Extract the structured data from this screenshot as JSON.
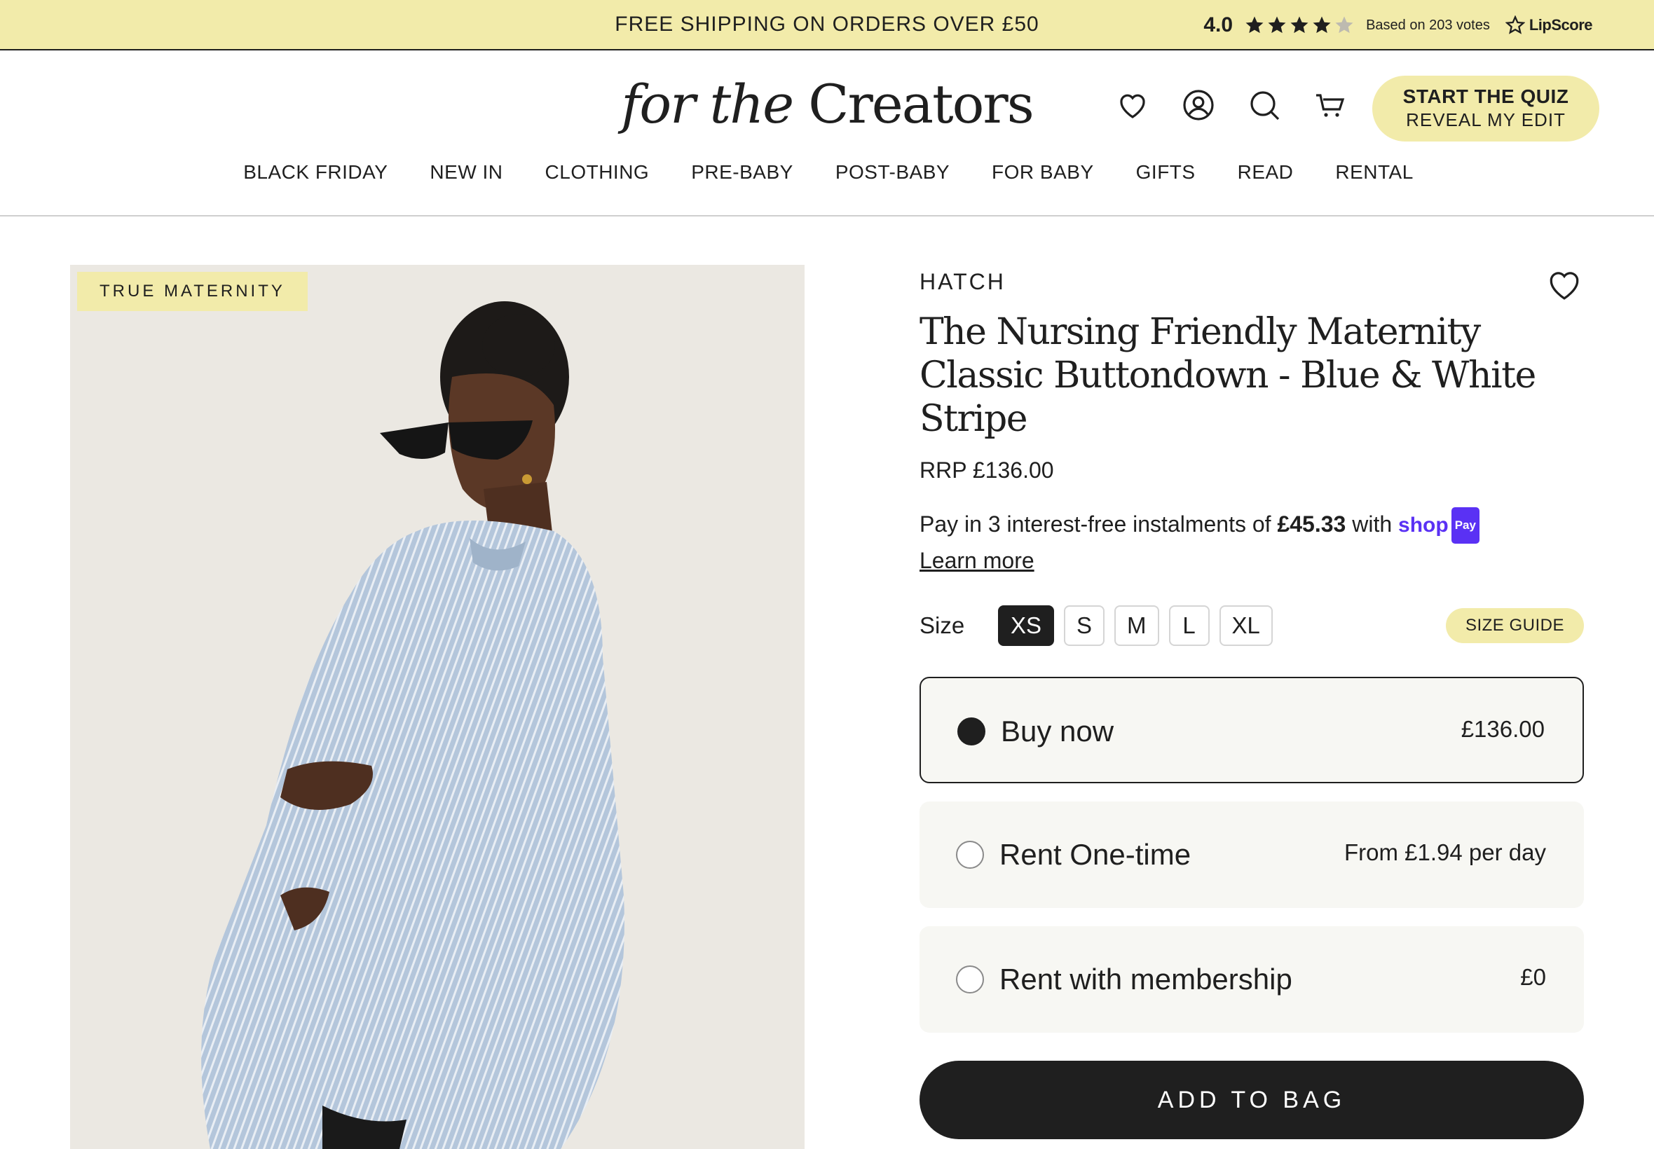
{
  "announcement": {
    "shipping_strong": "FREE SHIPPING",
    "shipping_rest": " ON ORDERS OVER £50",
    "rating_score": "4.0",
    "rating_votes": "Based on 203 votes",
    "rating_brand": "LipScore",
    "stars_filled": 4,
    "stars_total": 5
  },
  "header": {
    "logo_italic": "for the",
    "logo_rest": " Creators",
    "icons": [
      "heart-icon",
      "account-icon",
      "search-icon",
      "cart-icon"
    ],
    "quiz_line1": "START THE QUIZ",
    "quiz_line2": "REVEAL MY EDIT"
  },
  "nav": {
    "items": [
      "BLACK FRIDAY",
      "NEW IN",
      "CLOTHING",
      "PRE-BABY",
      "POST-BABY",
      "FOR BABY",
      "GIFTS",
      "READ",
      "RENTAL"
    ]
  },
  "product": {
    "badge": "TRUE MATERNITY",
    "brand": "HATCH",
    "title": "The Nursing Friendly Maternity Classic Buttondown - Blue & White Stripe",
    "rrp": "RRP £136.00",
    "pay_prefix": "Pay in 3 interest-free instalments of ",
    "pay_amount": "£45.33",
    "pay_with": " with ",
    "shoppay_word": "shop",
    "shoppay_pill": "Pay",
    "learn_more": "Learn more",
    "size_label": "Size",
    "sizes": [
      "XS",
      "S",
      "M",
      "L",
      "XL"
    ],
    "selected_size": "XS",
    "size_guide": "SIZE GUIDE",
    "options": [
      {
        "label": "Buy now",
        "price": "£136.00",
        "selected": true
      },
      {
        "label": "Rent One-time",
        "price": "From £1.94 per day",
        "selected": false
      },
      {
        "label": "Rent with membership",
        "price": "£0",
        "selected": false
      }
    ],
    "add_to_bag": "ADD TO BAG"
  },
  "colors": {
    "accent_yellow": "#f2ebaa",
    "dark": "#1f1f1f",
    "shoppay_purple": "#5a31f4",
    "option_bg": "#f7f7f3"
  }
}
